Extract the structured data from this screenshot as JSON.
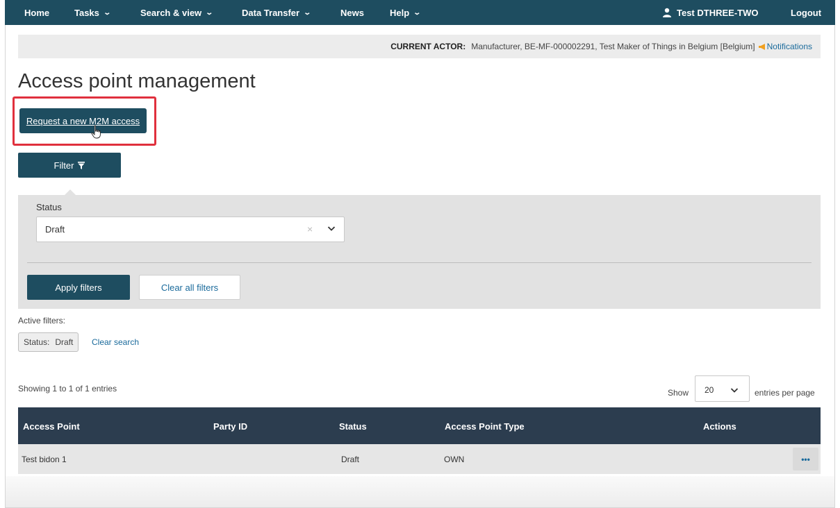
{
  "nav": {
    "home": "Home",
    "tasks": "Tasks",
    "search_view": "Search & view",
    "data_transfer": "Data Transfer",
    "news": "News",
    "help": "Help",
    "user": "Test DTHREE-TWO",
    "logout": "Logout",
    "chevron": "⌄",
    "bg_color": "#1e4d60"
  },
  "actor": {
    "label": "CURRENT ACTOR:",
    "value": "Manufacturer, BE-MF-000002291, Test Maker of Things in Belgium [Belgium]",
    "notifications": "Notifications"
  },
  "page": {
    "title": "Access point management",
    "request_button": "Request a new M2M access",
    "filter_button": "Filter"
  },
  "filters": {
    "status_label": "Status",
    "status_value": "Draft",
    "clear_x": "×",
    "apply": "Apply filters",
    "clear_all": "Clear all filters",
    "active_label": "Active filters:",
    "chip_key": "Status:",
    "chip_value": "Draft",
    "clear_search": "Clear search"
  },
  "pagination": {
    "showing": "Showing 1 to 1 of 1 entries",
    "show_label": "Show",
    "page_size": "20",
    "per_page": "entries per page"
  },
  "table": {
    "headers": [
      "Access Point",
      "Party ID",
      "Status",
      "Access Point Type",
      "Actions"
    ],
    "rows": [
      {
        "access_point": "Test bidon 1",
        "party_id": "",
        "status": "Draft",
        "type": "OWN",
        "actions": "•••"
      }
    ],
    "header_color": "#2c3d4f"
  },
  "colors": {
    "primary": "#1e4d60",
    "link": "#1a6a9b",
    "highlight": "#e0303d"
  }
}
